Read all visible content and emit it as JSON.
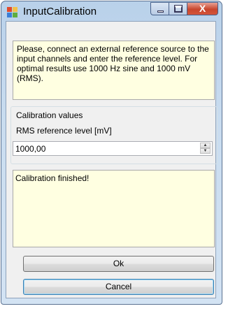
{
  "window": {
    "title": "InputCalibration",
    "icon": "app-icon",
    "caption_buttons": {
      "minimize_icon": "minimize-icon",
      "maximize_icon": "maximize-icon",
      "close_icon": "close-icon",
      "close_glyph": "X"
    }
  },
  "info_text": "Please, connect an external reference source to the input channels and enter the reference level. For optimal results use 1000 Hz sine and 1000 mV (RMS).",
  "calibration": {
    "group_title": "Calibration values",
    "field_label": "RMS reference level [mV]",
    "field_value": "1000,00"
  },
  "status_text": "Calibration finished!",
  "buttons": {
    "ok": "Ok",
    "cancel": "Cancel"
  },
  "colors": {
    "info_background": "#ffffe1",
    "title_bar": "#c9dcef",
    "close_button": "#c8462d"
  }
}
